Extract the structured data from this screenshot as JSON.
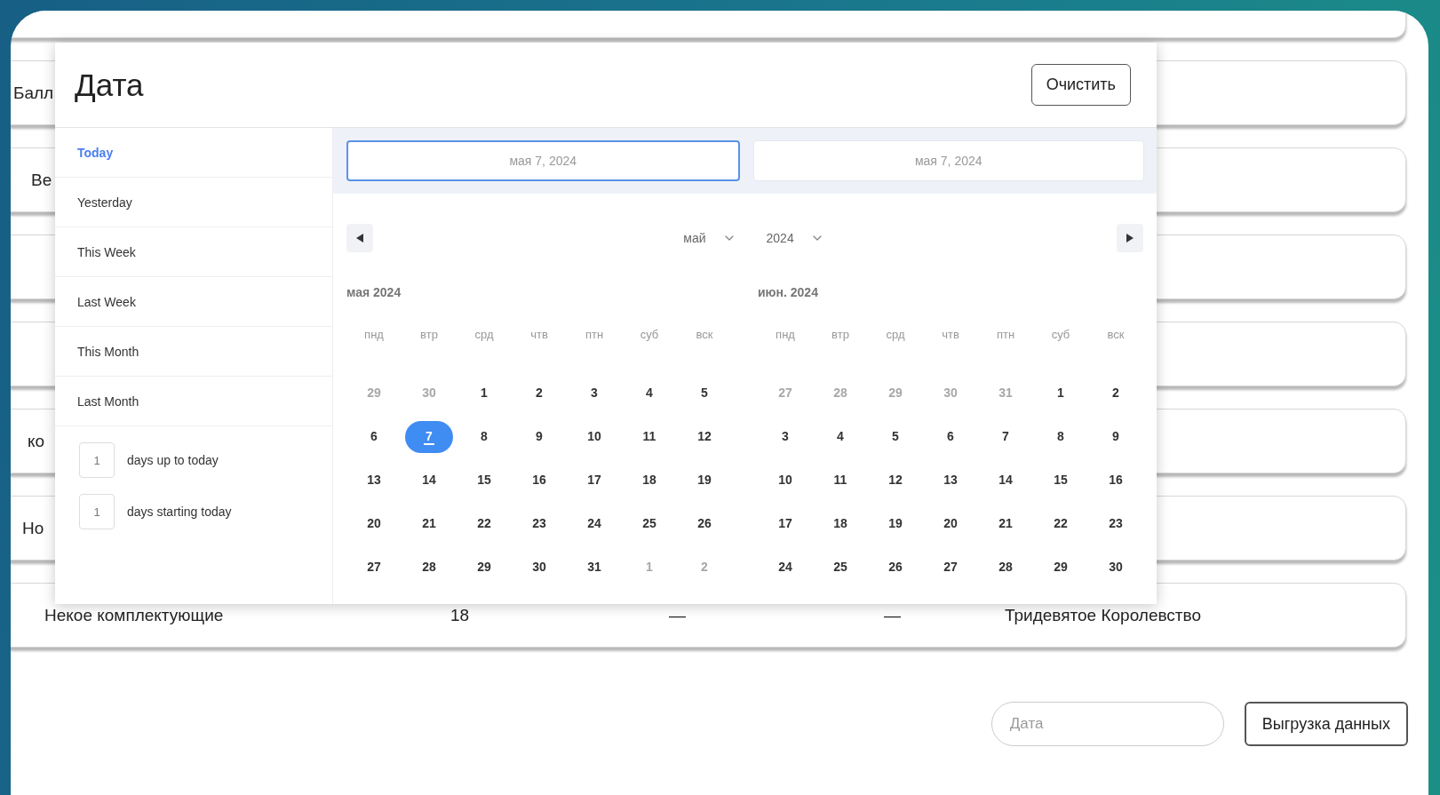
{
  "rows": [
    {
      "cells": []
    },
    {
      "cells": [
        "Балл"
      ]
    },
    {
      "cells": [
        "Ве"
      ]
    },
    {
      "cells": []
    },
    {
      "cells": []
    },
    {
      "cells": [
        "ко"
      ]
    },
    {
      "cells": [
        "Но"
      ]
    },
    {
      "cells": [
        "Некое комплектующие",
        "18",
        "—",
        "—",
        "Тридевятое Королевство"
      ]
    }
  ],
  "date_popup": {
    "title": "Дата",
    "clear_button": "Очистить",
    "presets": [
      {
        "label": "Today",
        "selected": true
      },
      {
        "label": "Yesterday",
        "selected": false
      },
      {
        "label": "This Week",
        "selected": false
      },
      {
        "label": "Last Week",
        "selected": false
      },
      {
        "label": "This Month",
        "selected": false
      },
      {
        "label": "Last Month",
        "selected": false
      }
    ],
    "day_ranges": [
      {
        "value": "1",
        "label": "days up to today"
      },
      {
        "value": "1",
        "label": "days starting today"
      }
    ],
    "range_inputs": [
      {
        "value": "мая 7, 2024",
        "selected": true
      },
      {
        "value": "мая 7, 2024",
        "selected": false
      }
    ],
    "month_select": "май",
    "year_select": "2024",
    "months": [
      {
        "title": "мая 2024",
        "weekdays": [
          "пнд",
          "втр",
          "срд",
          "чтв",
          "птн",
          "суб",
          "вск"
        ],
        "weeks": [
          [
            {
              "day": "29",
              "outside": true,
              "selected": false,
              "today": false
            },
            {
              "day": "30",
              "outside": true,
              "selected": false,
              "today": false
            },
            {
              "day": "1",
              "outside": false,
              "selected": false,
              "today": false
            },
            {
              "day": "2",
              "outside": false,
              "selected": false,
              "today": false
            },
            {
              "day": "3",
              "outside": false,
              "selected": false,
              "today": false
            },
            {
              "day": "4",
              "outside": false,
              "selected": false,
              "today": false
            },
            {
              "day": "5",
              "outside": false,
              "selected": false,
              "today": false
            }
          ],
          [
            {
              "day": "6",
              "outside": false,
              "selected": false,
              "today": false
            },
            {
              "day": "7",
              "outside": false,
              "selected": true,
              "today": true
            },
            {
              "day": "8",
              "outside": false,
              "selected": false,
              "today": false
            },
            {
              "day": "9",
              "outside": false,
              "selected": false,
              "today": false
            },
            {
              "day": "10",
              "outside": false,
              "selected": false,
              "today": false
            },
            {
              "day": "11",
              "outside": false,
              "selected": false,
              "today": false
            },
            {
              "day": "12",
              "outside": false,
              "selected": false,
              "today": false
            }
          ],
          [
            {
              "day": "13",
              "outside": false,
              "selected": false,
              "today": false
            },
            {
              "day": "14",
              "outside": false,
              "selected": false,
              "today": false
            },
            {
              "day": "15",
              "outside": false,
              "selected": false,
              "today": false
            },
            {
              "day": "16",
              "outside": false,
              "selected": false,
              "today": false
            },
            {
              "day": "17",
              "outside": false,
              "selected": false,
              "today": false
            },
            {
              "day": "18",
              "outside": false,
              "selected": false,
              "today": false
            },
            {
              "day": "19",
              "outside": false,
              "selected": false,
              "today": false
            }
          ],
          [
            {
              "day": "20",
              "outside": false,
              "selected": false,
              "today": false
            },
            {
              "day": "21",
              "outside": false,
              "selected": false,
              "today": false
            },
            {
              "day": "22",
              "outside": false,
              "selected": false,
              "today": false
            },
            {
              "day": "23",
              "outside": false,
              "selected": false,
              "today": false
            },
            {
              "day": "24",
              "outside": false,
              "selected": false,
              "today": false
            },
            {
              "day": "25",
              "outside": false,
              "selected": false,
              "today": false
            },
            {
              "day": "26",
              "outside": false,
              "selected": false,
              "today": false
            }
          ],
          [
            {
              "day": "27",
              "outside": false,
              "selected": false,
              "today": false
            },
            {
              "day": "28",
              "outside": false,
              "selected": false,
              "today": false
            },
            {
              "day": "29",
              "outside": false,
              "selected": false,
              "today": false
            },
            {
              "day": "30",
              "outside": false,
              "selected": false,
              "today": false
            },
            {
              "day": "31",
              "outside": false,
              "selected": false,
              "today": false
            },
            {
              "day": "1",
              "outside": true,
              "selected": false,
              "today": false
            },
            {
              "day": "2",
              "outside": true,
              "selected": false,
              "today": false
            }
          ]
        ]
      },
      {
        "title": "июн. 2024",
        "weekdays": [
          "пнд",
          "втр",
          "срд",
          "чтв",
          "птн",
          "суб",
          "вск"
        ],
        "weeks": [
          [
            {
              "day": "27",
              "outside": true,
              "selected": false,
              "today": false
            },
            {
              "day": "28",
              "outside": true,
              "selected": false,
              "today": false
            },
            {
              "day": "29",
              "outside": true,
              "selected": false,
              "today": false
            },
            {
              "day": "30",
              "outside": true,
              "selected": false,
              "today": false
            },
            {
              "day": "31",
              "outside": true,
              "selected": false,
              "today": false
            },
            {
              "day": "1",
              "outside": false,
              "selected": false,
              "today": false
            },
            {
              "day": "2",
              "outside": false,
              "selected": false,
              "today": false
            }
          ],
          [
            {
              "day": "3",
              "outside": false,
              "selected": false,
              "today": false
            },
            {
              "day": "4",
              "outside": false,
              "selected": false,
              "today": false
            },
            {
              "day": "5",
              "outside": false,
              "selected": false,
              "today": false
            },
            {
              "day": "6",
              "outside": false,
              "selected": false,
              "today": false
            },
            {
              "day": "7",
              "outside": false,
              "selected": false,
              "today": false
            },
            {
              "day": "8",
              "outside": false,
              "selected": false,
              "today": false
            },
            {
              "day": "9",
              "outside": false,
              "selected": false,
              "today": false
            }
          ],
          [
            {
              "day": "10",
              "outside": false,
              "selected": false,
              "today": false
            },
            {
              "day": "11",
              "outside": false,
              "selected": false,
              "today": false
            },
            {
              "day": "12",
              "outside": false,
              "selected": false,
              "today": false
            },
            {
              "day": "13",
              "outside": false,
              "selected": false,
              "today": false
            },
            {
              "day": "14",
              "outside": false,
              "selected": false,
              "today": false
            },
            {
              "day": "15",
              "outside": false,
              "selected": false,
              "today": false
            },
            {
              "day": "16",
              "outside": false,
              "selected": false,
              "today": false
            }
          ],
          [
            {
              "day": "17",
              "outside": false,
              "selected": false,
              "today": false
            },
            {
              "day": "18",
              "outside": false,
              "selected": false,
              "today": false
            },
            {
              "day": "19",
              "outside": false,
              "selected": false,
              "today": false
            },
            {
              "day": "20",
              "outside": false,
              "selected": false,
              "today": false
            },
            {
              "day": "21",
              "outside": false,
              "selected": false,
              "today": false
            },
            {
              "day": "22",
              "outside": false,
              "selected": false,
              "today": false
            },
            {
              "day": "23",
              "outside": false,
              "selected": false,
              "today": false
            }
          ],
          [
            {
              "day": "24",
              "outside": false,
              "selected": false,
              "today": false
            },
            {
              "day": "25",
              "outside": false,
              "selected": false,
              "today": false
            },
            {
              "day": "26",
              "outside": false,
              "selected": false,
              "today": false
            },
            {
              "day": "27",
              "outside": false,
              "selected": false,
              "today": false
            },
            {
              "day": "28",
              "outside": false,
              "selected": false,
              "today": false
            },
            {
              "day": "29",
              "outside": false,
              "selected": false,
              "today": false
            },
            {
              "day": "30",
              "outside": false,
              "selected": false,
              "today": false
            }
          ]
        ]
      }
    ]
  },
  "footer": {
    "date_field": {
      "placeholder": "Дата"
    },
    "export_button": "Выгрузка данных"
  }
}
